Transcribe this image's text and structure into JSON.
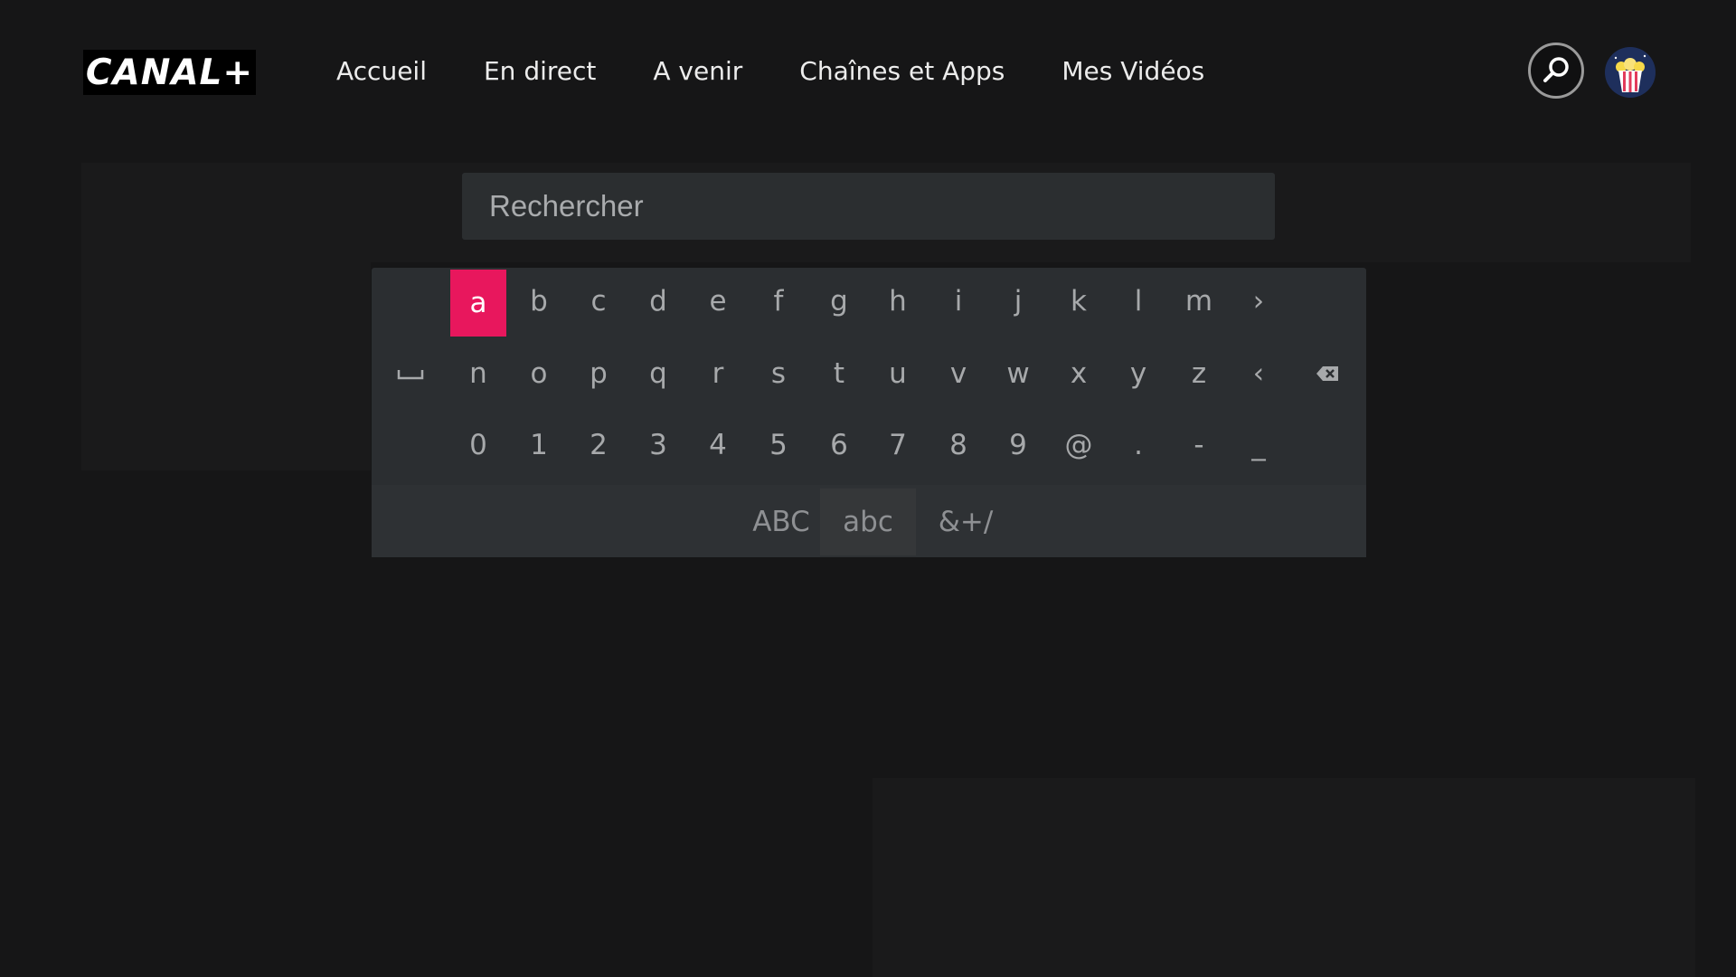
{
  "header": {
    "logo_text": "CANAL+",
    "nav": [
      {
        "label": "Accueil"
      },
      {
        "label": "En direct"
      },
      {
        "label": "A venir"
      },
      {
        "label": "Chaînes et Apps"
      },
      {
        "label": "Mes Vidéos"
      }
    ],
    "search_icon": "search-icon",
    "avatar_icon": "popcorn-avatar-icon"
  },
  "search": {
    "placeholder": "Rechercher"
  },
  "keyboard": {
    "selected_key": "a",
    "row1": [
      "a",
      "b",
      "c",
      "d",
      "e",
      "f",
      "g",
      "h",
      "i",
      "j",
      "k",
      "l",
      "m",
      "›"
    ],
    "row2": [
      "n",
      "o",
      "p",
      "q",
      "r",
      "s",
      "t",
      "u",
      "v",
      "w",
      "x",
      "y",
      "z",
      "‹"
    ],
    "row3": [
      "0",
      "1",
      "2",
      "3",
      "4",
      "5",
      "6",
      "7",
      "8",
      "9",
      "@",
      ".",
      "-",
      "_"
    ],
    "space_key_icon": "space-icon",
    "backspace_key_icon": "backspace-icon",
    "modes": [
      {
        "label": "ABC",
        "active": false
      },
      {
        "label": "abc",
        "active": true
      },
      {
        "label": "&+/",
        "active": false
      }
    ]
  },
  "colors": {
    "accent": "#e8175d",
    "background": "#161617",
    "panel": "#2b2e31"
  }
}
